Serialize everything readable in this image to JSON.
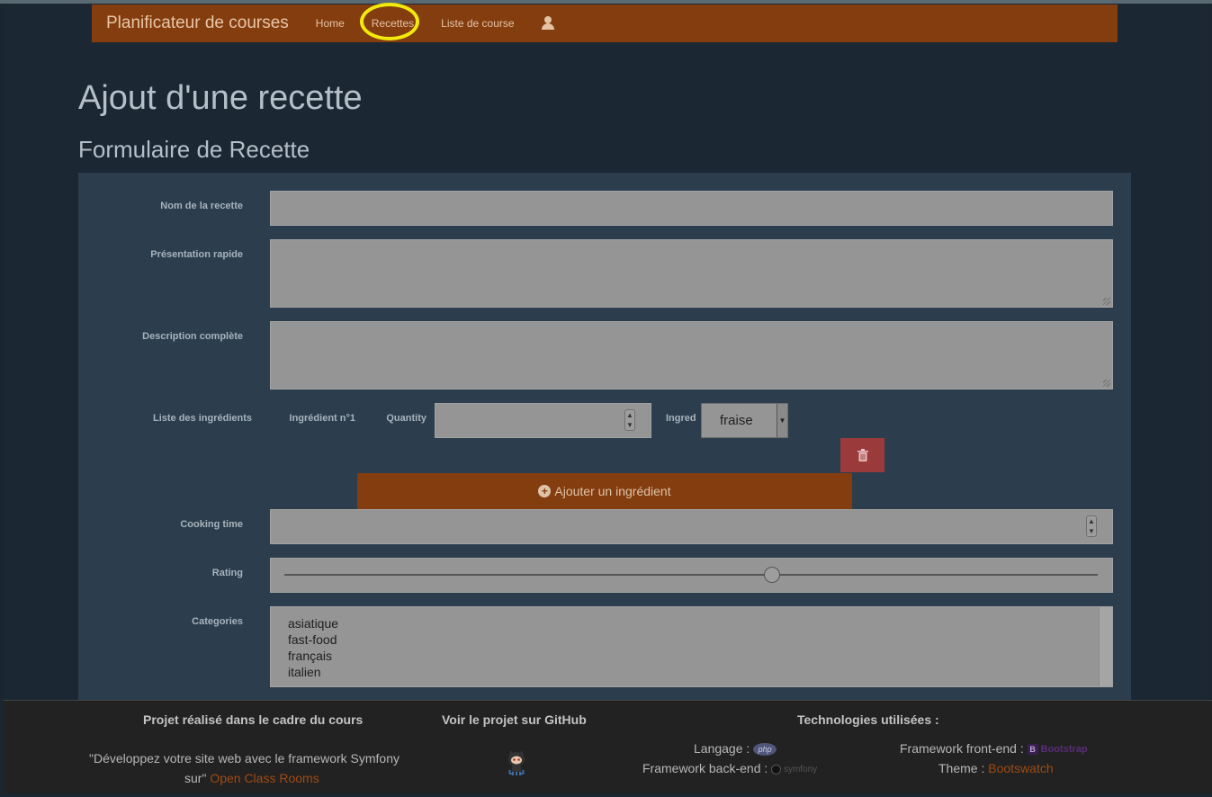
{
  "navbar": {
    "brand": "Planificateur de courses",
    "links": [
      "Home",
      "Recettes",
      "Liste de course"
    ],
    "user_icon": "user-icon",
    "accent": "#833d0f"
  },
  "page": {
    "title": "Ajout d'une recette",
    "form_title": "Formulaire de Recette"
  },
  "form": {
    "name_label": "Nom de la recette",
    "name_value": "",
    "intro_label": "Présentation rapide",
    "intro_value": "",
    "description_label": "Description complète",
    "description_value": "",
    "ingredients_label": "Liste des ingrédients",
    "ingredient_1": {
      "title": "Ingrédient n°1",
      "quantity_label": "Quantity",
      "quantity_value": "",
      "ingredient_label": "Ingred",
      "ingredient_value": "fraise"
    },
    "delete_icon": "trash-icon",
    "add_ingredient_label": "Ajouter un ingrédient",
    "add_icon": "plus-circle-icon",
    "cooking_time_label": "Cooking time",
    "cooking_time_value": "",
    "rating_label": "Rating",
    "rating_fraction": 0.6,
    "categories_label": "Categories",
    "categories": [
      "asiatique",
      "fast-food",
      "français",
      "italien"
    ],
    "delete_color": "#9b3a3a"
  },
  "footer": {
    "col1_title": "Projet réalisé dans le cadre du cours",
    "col1_text": "\"Développez votre site web avec le framework Symfony",
    "col1_text2": "sur\"",
    "col1_link": "Open Class Rooms",
    "col2_title": "Voir le projet sur GitHub",
    "github_icon": "github-octocat-icon",
    "col3_title": "Technologies utilisées :",
    "lang_label": "Langage :",
    "lang_badge": "php",
    "backend_label": "Framework back-end :",
    "backend_badge": "symfony",
    "frontend_label": "Framework front-end :",
    "frontend_badge": "Bootstrap",
    "theme_label": "Theme :",
    "theme_link": "Bootswatch"
  }
}
